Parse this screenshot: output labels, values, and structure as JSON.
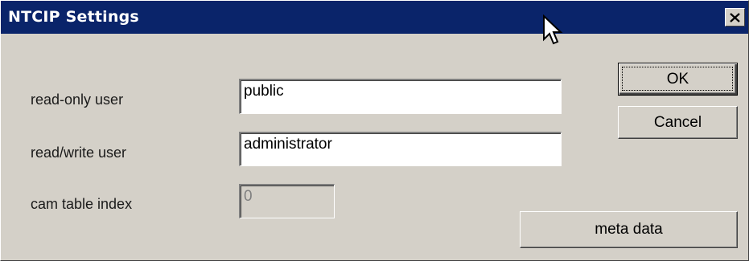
{
  "window": {
    "title": "NTCIP Settings",
    "close_glyph": "✕"
  },
  "fields": {
    "read_only_user": {
      "label": "read-only user",
      "value": "public"
    },
    "read_write_user": {
      "label": "read/write user",
      "value": "administrator"
    },
    "cam_table_index": {
      "label": "cam table index",
      "value": "0",
      "disabled": true
    }
  },
  "buttons": {
    "ok": "OK",
    "cancel": "Cancel",
    "meta_data": "meta data"
  },
  "colors": {
    "titlebar": "#0a246a",
    "dialog_bg": "#d4d0c8"
  },
  "icons": {
    "close": "close-icon",
    "cursor": "mouse-pointer-icon"
  }
}
